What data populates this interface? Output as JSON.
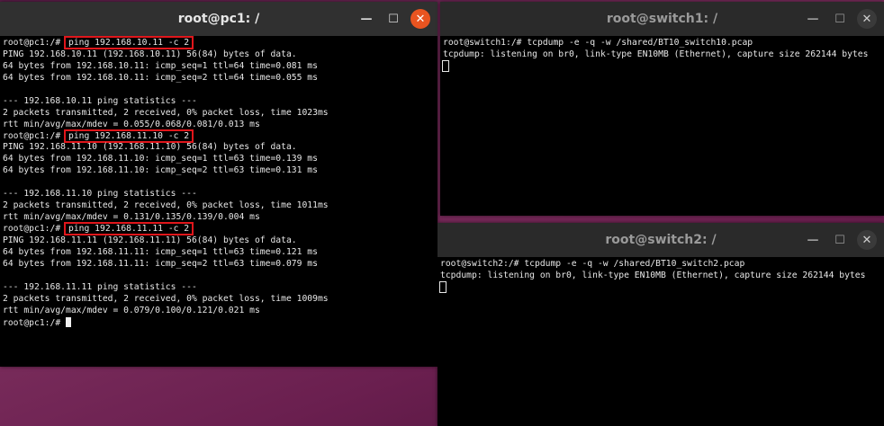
{
  "pc1": {
    "title": "root@pc1: /",
    "minimize": "—",
    "maximize": "☐",
    "close": "✕",
    "lines": [
      {
        "prefix": "root@pc1:/# ",
        "cmd": "ping 192.168.10.11 -c 2"
      },
      {
        "text": "PING 192.168.10.11 (192.168.10.11) 56(84) bytes of data."
      },
      {
        "text": "64 bytes from 192.168.10.11: icmp_seq=1 ttl=64 time=0.081 ms"
      },
      {
        "text": "64 bytes from 192.168.10.11: icmp_seq=2 ttl=64 time=0.055 ms"
      },
      {
        "text": ""
      },
      {
        "text": "--- 192.168.10.11 ping statistics ---"
      },
      {
        "text": "2 packets transmitted, 2 received, 0% packet loss, time 1023ms"
      },
      {
        "text": "rtt min/avg/max/mdev = 0.055/0.068/0.081/0.013 ms"
      },
      {
        "prefix": "root@pc1:/# ",
        "cmd": "ping 192.168.11.10 -c 2"
      },
      {
        "text": "PING 192.168.11.10 (192.168.11.10) 56(84) bytes of data."
      },
      {
        "text": "64 bytes from 192.168.11.10: icmp_seq=1 ttl=63 time=0.139 ms"
      },
      {
        "text": "64 bytes from 192.168.11.10: icmp_seq=2 ttl=63 time=0.131 ms"
      },
      {
        "text": ""
      },
      {
        "text": "--- 192.168.11.10 ping statistics ---"
      },
      {
        "text": "2 packets transmitted, 2 received, 0% packet loss, time 1011ms"
      },
      {
        "text": "rtt min/avg/max/mdev = 0.131/0.135/0.139/0.004 ms"
      },
      {
        "prefix": "root@pc1:/# ",
        "cmd": "ping 192.168.11.11 -c 2"
      },
      {
        "text": "PING 192.168.11.11 (192.168.11.11) 56(84) bytes of data."
      },
      {
        "text": "64 bytes from 192.168.11.11: icmp_seq=1 ttl=63 time=0.121 ms"
      },
      {
        "text": "64 bytes from 192.168.11.11: icmp_seq=2 ttl=63 time=0.079 ms"
      },
      {
        "text": ""
      },
      {
        "text": "--- 192.168.11.11 ping statistics ---"
      },
      {
        "text": "2 packets transmitted, 2 received, 0% packet loss, time 1009ms"
      },
      {
        "text": "rtt min/avg/max/mdev = 0.079/0.100/0.121/0.021 ms"
      },
      {
        "text": "root@pc1:/# ",
        "cursor": "solid"
      }
    ]
  },
  "switch1": {
    "title": "root@switch1: /",
    "minimize": "—",
    "maximize": "☐",
    "close": "✕",
    "lines": [
      {
        "text": "root@switch1:/# tcpdump -e -q -w /shared/BT10_switch10.pcap"
      },
      {
        "text": "tcpdump: listening on br0, link-type EN10MB (Ethernet), capture size 262144 bytes"
      },
      {
        "text": "",
        "cursor": "hollow"
      }
    ]
  },
  "switch2": {
    "title": "root@switch2: /",
    "minimize": "—",
    "maximize": "☐",
    "close": "✕",
    "lines": [
      {
        "text": "root@switch2:/# tcpdump -e -q -w /shared/BT10_switch2.pcap"
      },
      {
        "text": "tcpdump: listening on br0, link-type EN10MB (Ethernet), capture size 262144 bytes"
      },
      {
        "text": "",
        "cursor": "hollow"
      }
    ]
  }
}
